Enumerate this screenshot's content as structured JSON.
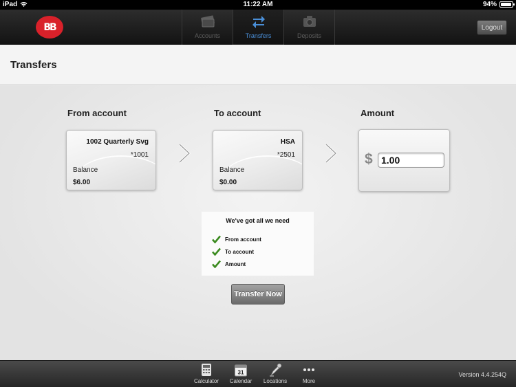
{
  "status_bar": {
    "device": "iPad",
    "time": "11:22 AM",
    "battery": "94%",
    "battery_level": 0.94
  },
  "nav": {
    "logout_label": "Logout",
    "tabs": [
      {
        "label": "Accounts",
        "icon": "wallet-icon",
        "active": false
      },
      {
        "label": "Transfers",
        "icon": "transfer-arrows-icon",
        "active": true
      },
      {
        "label": "Deposits",
        "icon": "camera-icon",
        "active": false
      }
    ]
  },
  "page": {
    "title": "Transfers"
  },
  "transfer": {
    "from_heading": "From account",
    "to_heading": "To account",
    "amount_heading": "Amount",
    "from_card": {
      "name": "1002 Quarterly Svg",
      "number": "*1001",
      "balance_label": "Balance",
      "balance": "$6.00"
    },
    "to_card": {
      "name": "HSA",
      "number": "*2501",
      "balance_label": "Balance",
      "balance": "$0.00"
    },
    "currency_symbol": "$",
    "amount_value": "1.00",
    "checklist": {
      "heading": "We've got all we need",
      "items": [
        "From account",
        "To account",
        "Amount"
      ]
    },
    "submit_label": "Transfer Now"
  },
  "bottom_bar": {
    "tools": [
      {
        "label": "Calculator",
        "icon": "calculator-icon"
      },
      {
        "label": "Calendar",
        "icon": "calendar-icon",
        "day": "31"
      },
      {
        "label": "Locations",
        "icon": "map-pin-icon"
      },
      {
        "label": "More",
        "icon": "more-dots-icon"
      }
    ],
    "version": "Version 4.4.254Q"
  },
  "colors": {
    "brand_red": "#d9212a",
    "active_tab": "#4a8fd8",
    "check_green": "#3a8a1e"
  }
}
